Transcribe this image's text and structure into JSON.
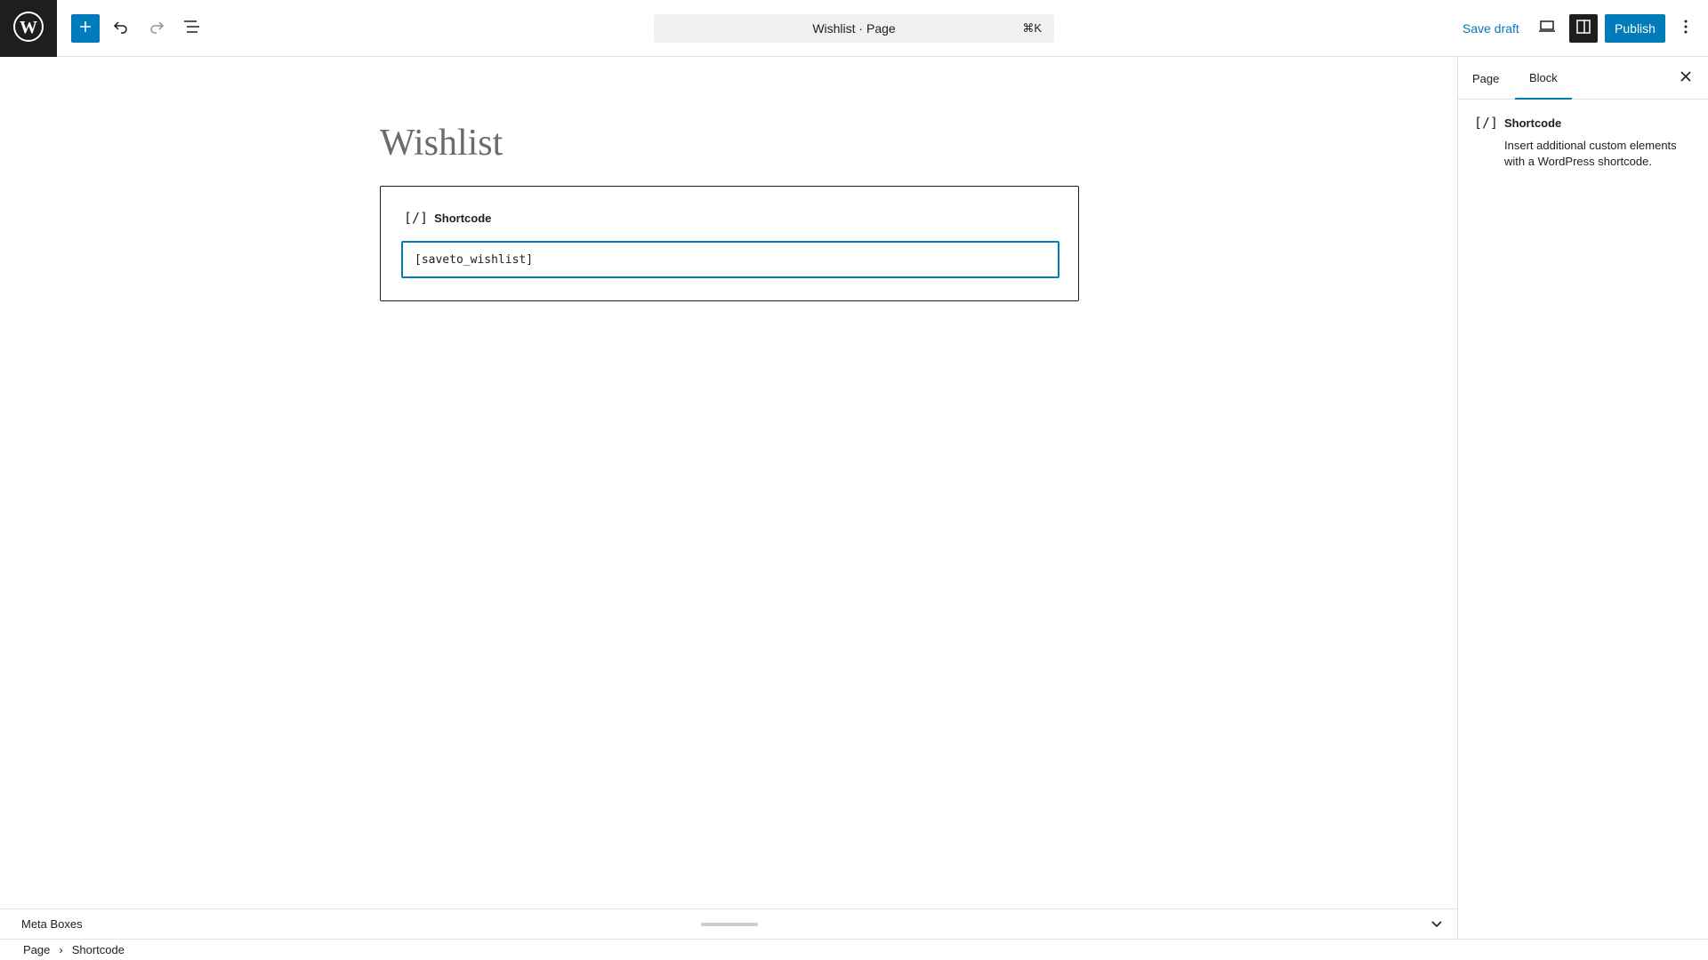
{
  "header": {
    "logo_icon": "wordpress-logo-icon",
    "inserter_icon": "plus-icon",
    "undo_icon": "undo-icon",
    "redo_icon": "redo-icon",
    "document_overview_icon": "list-view-icon",
    "command_title": "Wishlist · Page",
    "command_shortcut": "⌘K",
    "save_draft_label": "Save draft",
    "preview_icon": "desktop-preview-icon",
    "settings_icon": "sidebar-toggle-icon",
    "publish_label": "Publish",
    "more_icon": "more-vertical-icon"
  },
  "editor": {
    "post_title": "Wishlist",
    "block": {
      "icon_glyph": "[/]",
      "label": "Shortcode",
      "input_value": "[saveto_wishlist]"
    }
  },
  "meta_boxes": {
    "title": "Meta Boxes"
  },
  "breadcrumb": {
    "items": [
      "Page",
      "Shortcode"
    ],
    "separator": "›"
  },
  "sidebar": {
    "tabs": [
      {
        "label": "Page",
        "active": false
      },
      {
        "label": "Block",
        "active": true
      }
    ],
    "close_icon": "close-icon",
    "block_card": {
      "icon_glyph": "[/]",
      "title": "Shortcode",
      "description": "Insert additional custom elements with a WordPress shortcode."
    }
  },
  "colors": {
    "accent": "#007cba",
    "dark": "#1e1e1e",
    "border": "#e0e0e0"
  }
}
